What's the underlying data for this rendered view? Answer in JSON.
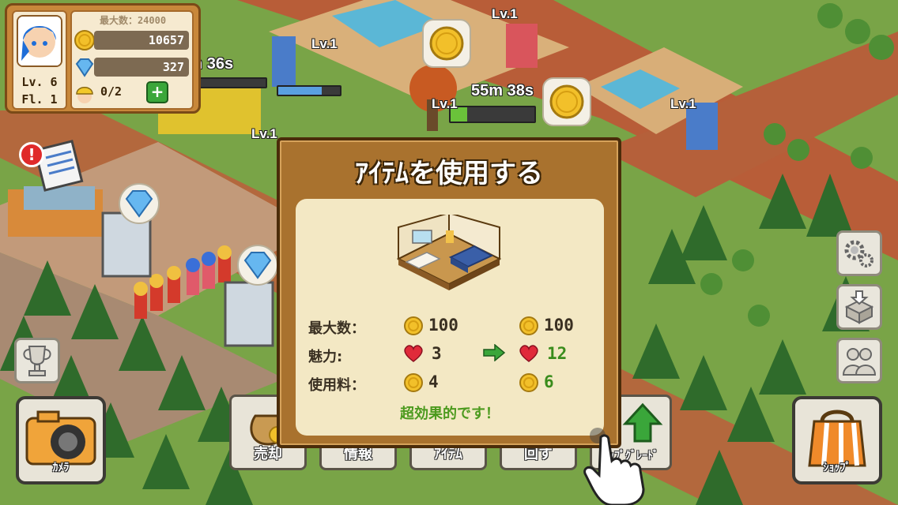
{
  "hud": {
    "max_label": "最大数：24000",
    "gold": "10657",
    "gems": "327",
    "workers": "0/2",
    "plus": "+",
    "level": "Lv. 6",
    "floor": "Fl. 1"
  },
  "world": {
    "timer_left": "n 36s",
    "timer_center": "55m 38s",
    "level_tags": [
      "Lv.1",
      "Lv.1",
      "Lv.1",
      "Lv.1",
      "Lv.1"
    ],
    "alert": "!"
  },
  "dialog": {
    "title": "ｱｲﾃﾑを使用する",
    "rows": [
      {
        "label": "最大数：",
        "before": "100",
        "after": "100",
        "icon": "coin"
      },
      {
        "label": "魅力:",
        "before": "3",
        "after": "12",
        "icon": "heart"
      },
      {
        "label": "使用料：",
        "before": "4",
        "after": "6",
        "icon": "coin"
      }
    ],
    "note": "超効果的です！"
  },
  "buttons": {
    "camera": "ｶﾒﾗ",
    "shop": "ｼｮｯﾌﾟ",
    "sell": "売却",
    "info": "情報",
    "item": "ｱｲﾃﾑ",
    "rotate": "回す",
    "upgrade": "ｱｯﾌﾟｸﾞﾚｰﾄﾞ"
  },
  "colors": {
    "dialog_bg": "#a9722e",
    "panel_bg": "#f3e8c4",
    "positive": "#3a8c1c",
    "hud_bg": "#c8873a"
  }
}
